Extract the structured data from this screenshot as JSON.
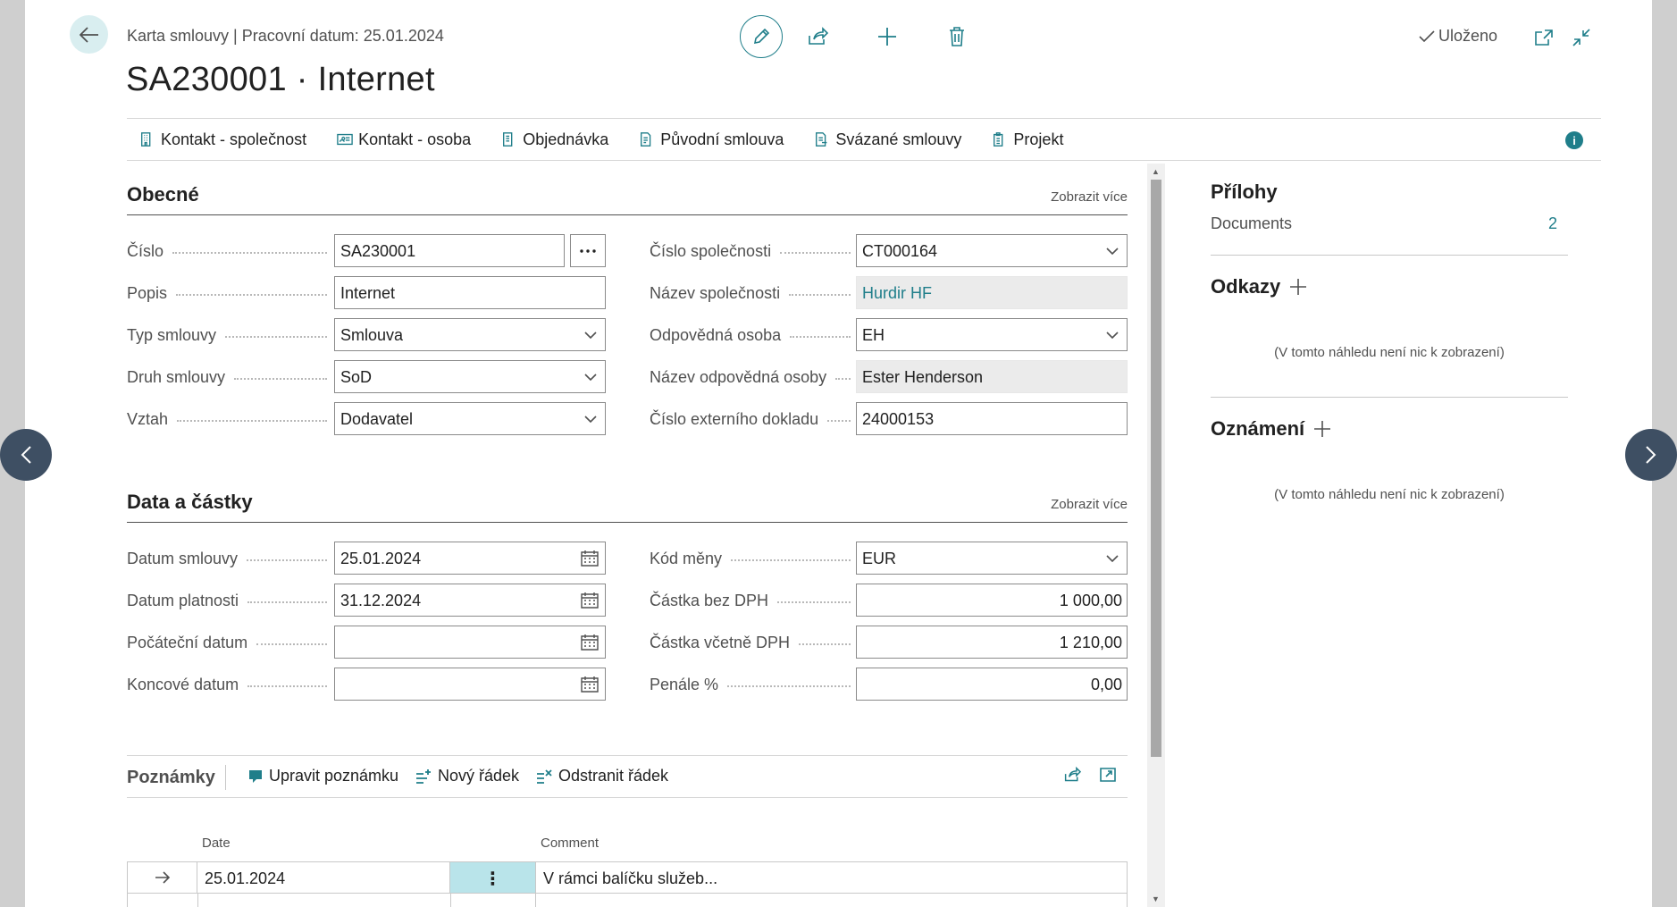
{
  "header": {
    "breadcrumb": "Karta smlouvy | Pracovní datum: 25.01.2024",
    "title": "SA230001 · Internet",
    "saved_label": "Uloženo"
  },
  "actions": [
    {
      "label": "Kontakt - společnost",
      "icon": "company-contact-icon"
    },
    {
      "label": "Kontakt - osoba",
      "icon": "person-contact-icon"
    },
    {
      "label": "Objednávka",
      "icon": "order-icon"
    },
    {
      "label": "Původní smlouva",
      "icon": "original-contract-icon"
    },
    {
      "label": "Svázané smlouvy",
      "icon": "linked-contracts-icon"
    },
    {
      "label": "Projekt",
      "icon": "project-icon"
    }
  ],
  "general": {
    "title": "Obecné",
    "show_more": "Zobrazit více",
    "left": [
      {
        "label": "Číslo",
        "value": "SA230001"
      },
      {
        "label": "Popis",
        "value": "Internet"
      },
      {
        "label": "Typ smlouvy",
        "value": "Smlouva"
      },
      {
        "label": "Druh smlouvy",
        "value": "SoD"
      },
      {
        "label": "Vztah",
        "value": "Dodavatel"
      }
    ],
    "right": [
      {
        "label": "Číslo společnosti",
        "value": "CT000164"
      },
      {
        "label": "Název společnosti",
        "value": "Hurdir HF"
      },
      {
        "label": "Odpovědná osoba",
        "value": "EH"
      },
      {
        "label": "Název odpovědná osoby",
        "value": "Ester Henderson"
      },
      {
        "label": "Číslo externího dokladu",
        "value": "24000153"
      }
    ]
  },
  "amounts": {
    "title": "Data a částky",
    "show_more": "Zobrazit více",
    "left": [
      {
        "label": "Datum smlouvy",
        "value": "25.01.2024"
      },
      {
        "label": "Datum platnosti",
        "value": "31.12.2024"
      },
      {
        "label": "Počáteční datum",
        "value": ""
      },
      {
        "label": "Koncové datum",
        "value": ""
      }
    ],
    "right": [
      {
        "label": "Kód měny",
        "value": "EUR"
      },
      {
        "label": "Částka bez DPH",
        "value": "1 000,00"
      },
      {
        "label": "Částka včetně DPH",
        "value": "1 210,00"
      },
      {
        "label": "Penále %",
        "value": "0,00"
      }
    ]
  },
  "notes": {
    "title": "Poznámky",
    "edit_label": "Upravit poznámku",
    "new_label": "Nový řádek",
    "delete_label": "Odstranit řádek",
    "columns": {
      "date": "Date",
      "comment": "Comment"
    },
    "rows": [
      {
        "date": "25.01.2024",
        "comment": "V rámci balíčku služeb..."
      }
    ]
  },
  "factbox": {
    "attachments_title": "Přílohy",
    "documents_label": "Documents",
    "documents_count": "2",
    "links_title": "Odkazy",
    "links_empty": "(V tomto náhledu není nic k zobrazení)",
    "notifications_title": "Oznámení",
    "notifications_empty": "(V tomto náhledu není nic k zobrazení)"
  },
  "colors": {
    "accent": "#1f7e8a",
    "nav_circle": "#3e4f63",
    "readonly_bg": "#ebebeb"
  }
}
